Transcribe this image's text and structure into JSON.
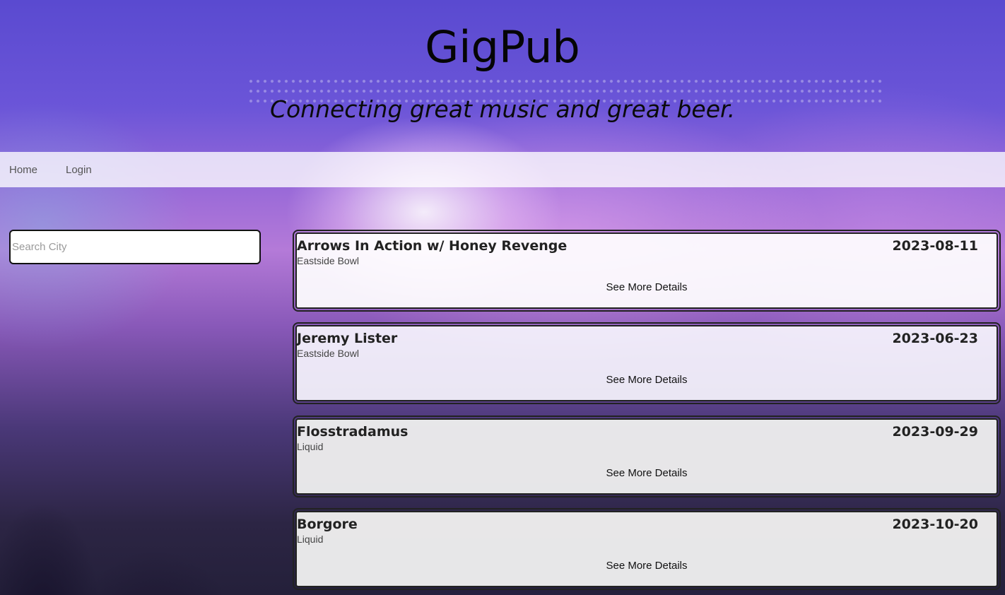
{
  "header": {
    "title": "GigPub",
    "tagline": "Connecting great music and great beer."
  },
  "nav": {
    "items": [
      {
        "label": "Home"
      },
      {
        "label": "Login"
      }
    ]
  },
  "search": {
    "placeholder": "Search City",
    "value": ""
  },
  "events": [
    {
      "name": "Arrows In Action w/ Honey Revenge",
      "venue": "Eastside Bowl",
      "date": "2023-08-11",
      "details_label": "See More Details"
    },
    {
      "name": "Jeremy Lister",
      "venue": "Eastside Bowl",
      "date": "2023-06-23",
      "details_label": "See More Details"
    },
    {
      "name": "Flosstradamus",
      "venue": "Liquid",
      "date": "2023-09-29",
      "details_label": "See More Details"
    },
    {
      "name": "Borgore",
      "venue": "Liquid",
      "date": "2023-10-20",
      "details_label": "See More Details"
    }
  ]
}
